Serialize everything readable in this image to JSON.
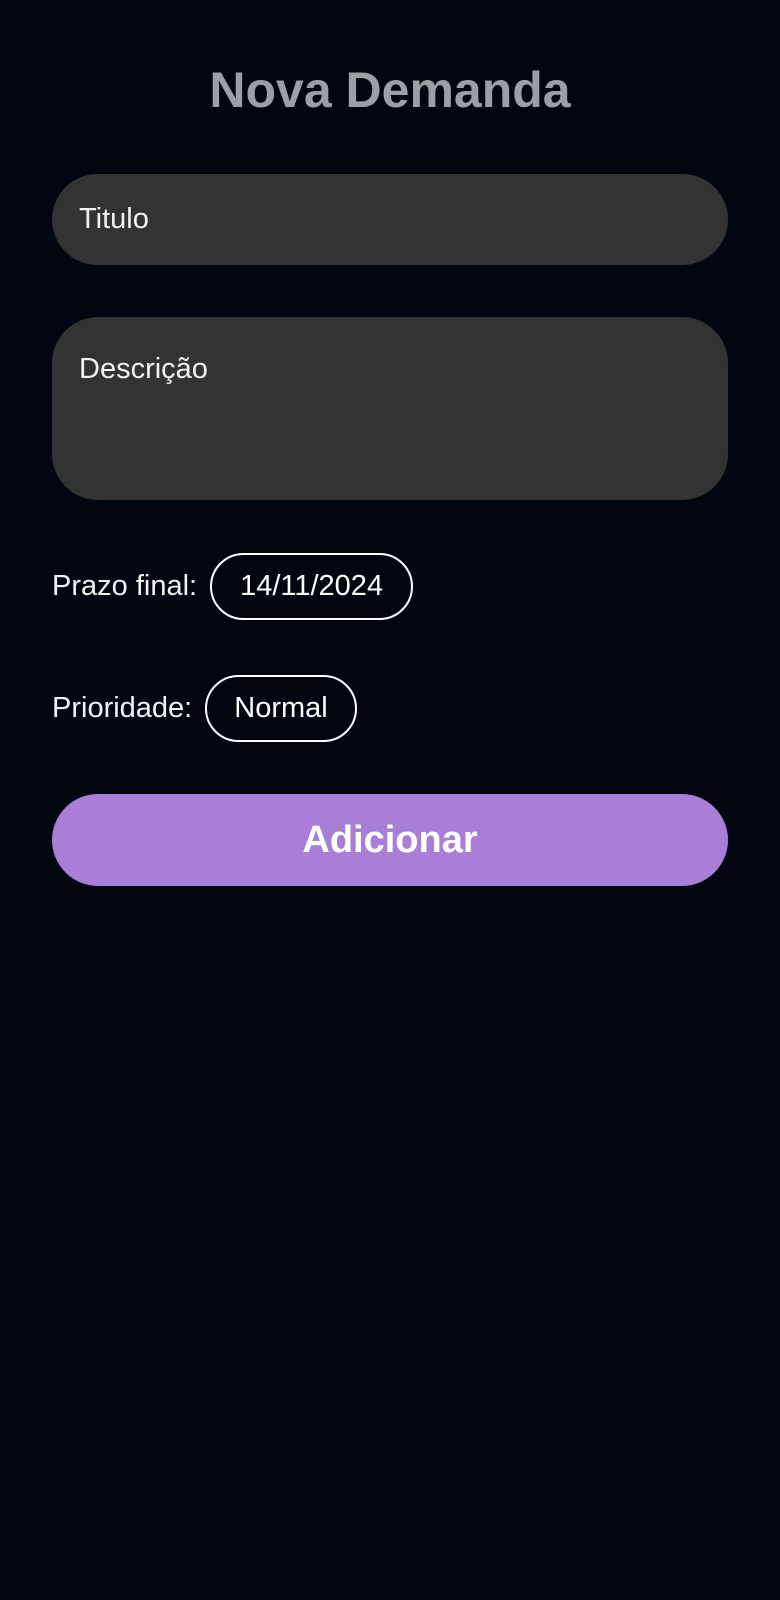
{
  "page": {
    "title": "Nova Demanda"
  },
  "form": {
    "title_field": {
      "placeholder": "Titulo",
      "value": ""
    },
    "description_field": {
      "placeholder": "Descrição",
      "value": ""
    },
    "deadline": {
      "label": "Prazo final:",
      "value": "14/11/2024"
    },
    "priority": {
      "label": "Prioridade:",
      "value": "Normal"
    },
    "submit_label": "Adicionar"
  },
  "colors": {
    "background": "#020610",
    "field_background": "#333333",
    "title_color": "#9d9fa4",
    "accent": "#a97ed6"
  }
}
